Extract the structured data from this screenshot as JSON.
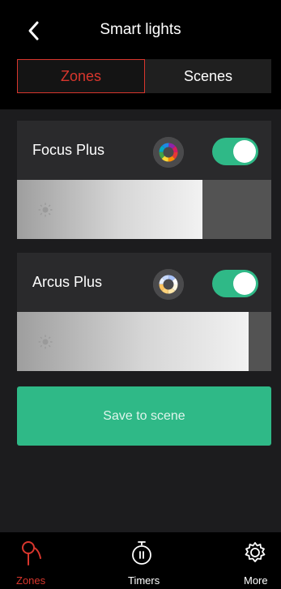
{
  "header": {
    "title": "Smart lights"
  },
  "tabs": [
    {
      "label": "Zones",
      "active": true
    },
    {
      "label": "Scenes",
      "active": false
    }
  ],
  "lights": [
    {
      "name": "Focus Plus",
      "on": true,
      "brightness_fraction": 0.73
    },
    {
      "name": "Arcus Plus",
      "on": true,
      "brightness_fraction": 0.91
    }
  ],
  "save_button": {
    "label": "Save to scene"
  },
  "nav": {
    "items": [
      {
        "label": "Zones",
        "active": true
      },
      {
        "label": "Timers",
        "active": false
      },
      {
        "label": "More",
        "active": false
      }
    ]
  },
  "colors": {
    "accent_red": "#d8362d",
    "accent_green": "#2fb987",
    "background": "#1c1c1e",
    "card": "#2a2a2c"
  }
}
